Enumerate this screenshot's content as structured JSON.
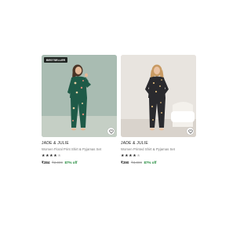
{
  "products": [
    {
      "badge": "BESTSELLER",
      "brand": "JADE & JULIE",
      "title": "Women Floral Print Shirt & Pyjamas Set",
      "rating": 4,
      "price": "₹384",
      "mrp": "₹2,999",
      "discount": "87% off",
      "image_bg": "#a9bcb2",
      "outfit_color": "#1e5a47",
      "icons": {
        "wishlist": "heart-icon"
      }
    },
    {
      "brand": "JADE & JULIE",
      "title": "Women Printed Shirt & Pyjamas Set",
      "rating": 4,
      "price": "₹390",
      "mrp": "₹3,099",
      "discount": "87% off",
      "image_bg": "#e8e4df",
      "outfit_color": "#2a2a2e",
      "icons": {
        "wishlist": "heart-icon"
      }
    }
  ],
  "colors": {
    "discount": "#1f8a3a",
    "badge_bg": "#1f2421"
  }
}
